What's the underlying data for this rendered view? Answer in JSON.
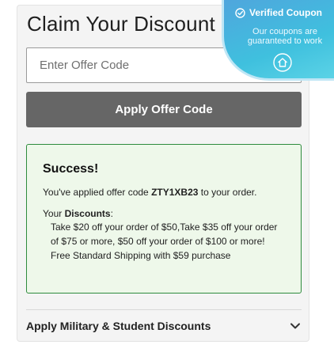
{
  "discount_panel": {
    "title": "Claim Your Discount",
    "offer_input": {
      "placeholder": "Enter Offer Code",
      "value": ""
    },
    "apply_button_label": "Apply Offer Code",
    "success": {
      "heading": "Success!",
      "applied_prefix": "You've applied offer code ",
      "offer_code": "ZTY1XB23",
      "applied_suffix": " to your order.",
      "discounts_prefix": "Your ",
      "discounts_label": "Discounts",
      "discounts_suffix": ":",
      "discounts": [
        "Take $20 off your order of $50,Take $35 off your order of $75 or more, $50 off your order of $100 or more!",
        "Free Standard Shipping with $59 purchase"
      ]
    },
    "military_section": {
      "label": "Apply Military & Student Discounts",
      "expand_icon": "chevron-down-icon"
    }
  },
  "verified_badge": {
    "title": "Verified Coupon",
    "subtitle": "Our coupons are guaranteed to work",
    "icons": [
      "check-circle-icon",
      "home-icon"
    ]
  },
  "colors": {
    "apply_button": "#666666",
    "success_border": "#2e8b3d",
    "success_background": "#eef8ea",
    "badge_gradient_start": "#4fa6dd",
    "badge_gradient_end": "#5bd3e6"
  }
}
